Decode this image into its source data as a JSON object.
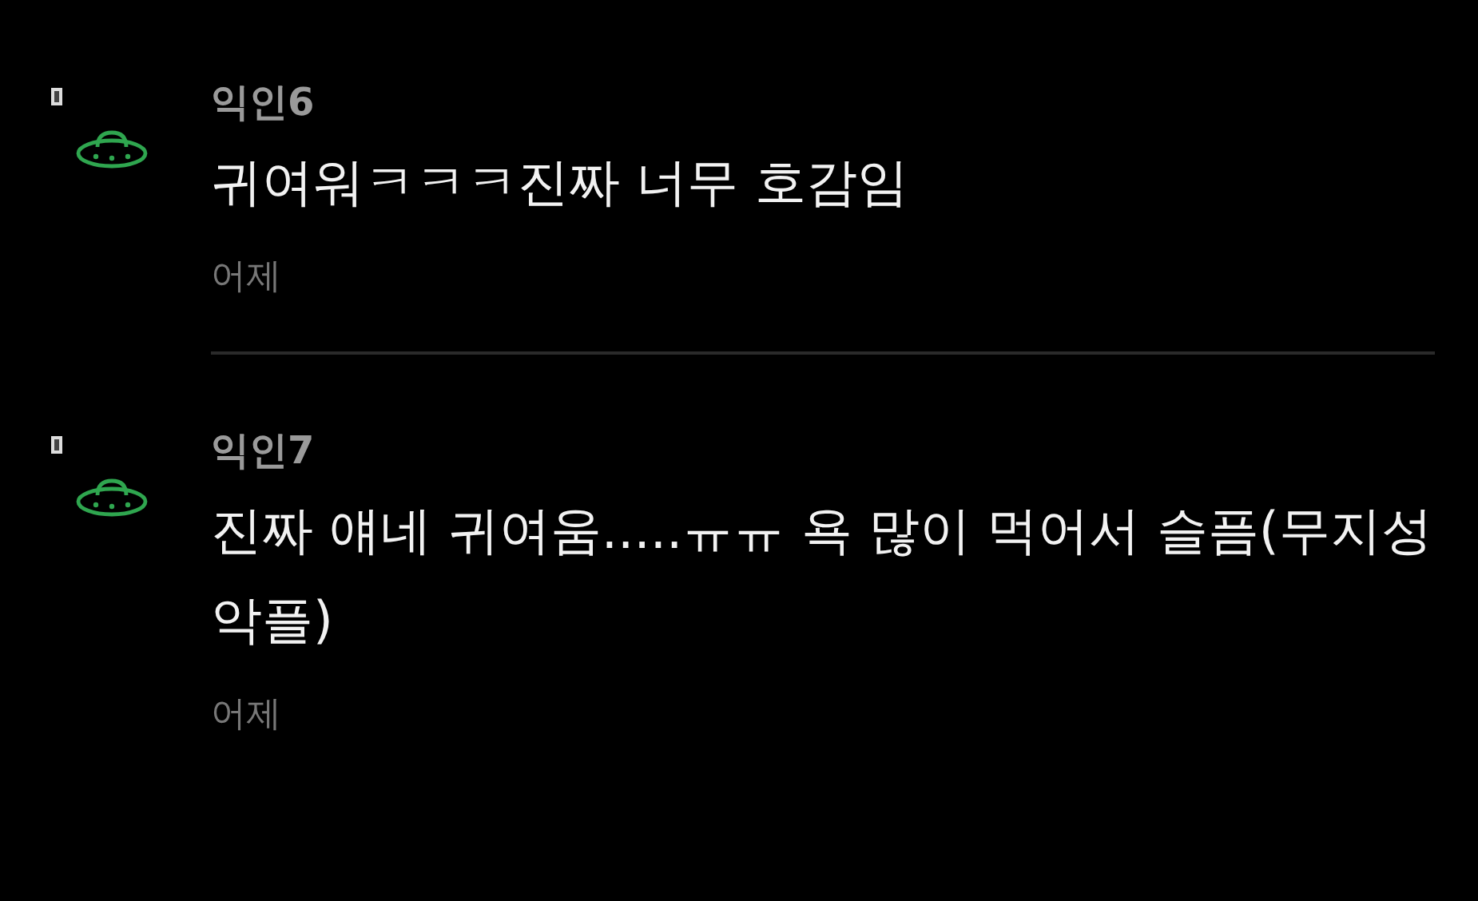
{
  "comments": [
    {
      "author": "익인6",
      "text": "귀여워ㅋㅋㅋ진짜 너무 호감임",
      "time": "어제"
    },
    {
      "author": "익인7",
      "text": "진짜 얘네 귀여움.....ㅠㅠ 욕 많이 먹어서 슬픔(무지성악플)",
      "time": "어제"
    }
  ]
}
